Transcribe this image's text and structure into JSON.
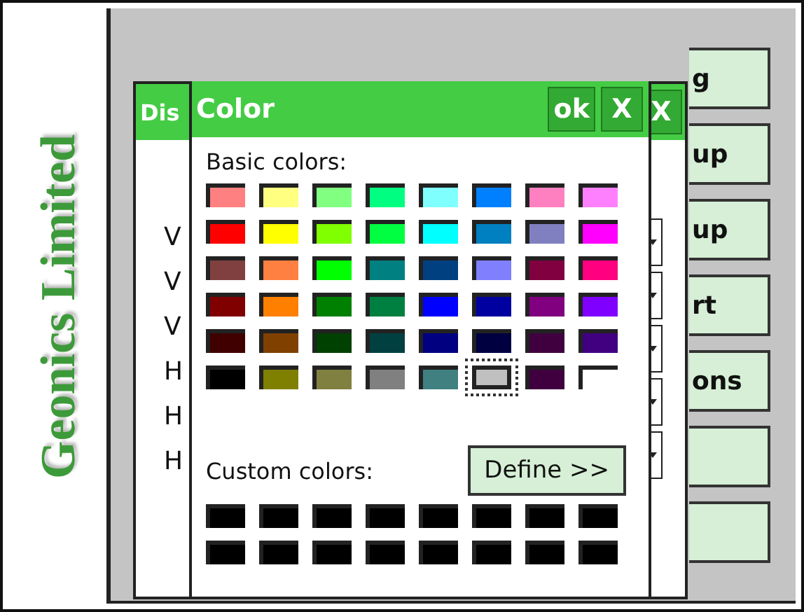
{
  "logo": {
    "text": "Geonics Limited"
  },
  "side_buttons": [
    {
      "kind": "labeled",
      "label": "g"
    },
    {
      "kind": "labeled",
      "label": "up"
    },
    {
      "kind": "labeled",
      "label": "up"
    },
    {
      "kind": "labeled",
      "label": "rt"
    },
    {
      "kind": "labeled",
      "label": "ons"
    },
    {
      "kind": "blank"
    },
    {
      "kind": "blank"
    }
  ],
  "back_dialog": {
    "title": "Dis",
    "row_labels": [
      "V",
      "V",
      "V",
      "H",
      "H",
      "H"
    ],
    "close_label": "X"
  },
  "color_dialog": {
    "title": "Color",
    "ok_label": "ok",
    "close_label": "X",
    "basic_label": "Basic colors:",
    "custom_label": "Custom colors:",
    "define_label": "Define >>",
    "basic_colors": [
      {
        "color": "#ff8080",
        "selected": false
      },
      {
        "color": "#ffff80",
        "selected": false
      },
      {
        "color": "#80ff80",
        "selected": false
      },
      {
        "color": "#00ff80",
        "selected": false
      },
      {
        "color": "#80ffff",
        "selected": false
      },
      {
        "color": "#0080ff",
        "selected": false
      },
      {
        "color": "#ff80c0",
        "selected": false
      },
      {
        "color": "#ff80ff",
        "selected": false
      },
      {
        "color": "#ff0000",
        "selected": false
      },
      {
        "color": "#ffff00",
        "selected": false
      },
      {
        "color": "#80ff00",
        "selected": false
      },
      {
        "color": "#00ff40",
        "selected": false
      },
      {
        "color": "#00ffff",
        "selected": false
      },
      {
        "color": "#0080c0",
        "selected": false
      },
      {
        "color": "#8080c0",
        "selected": false
      },
      {
        "color": "#ff00ff",
        "selected": false
      },
      {
        "color": "#804040",
        "selected": false
      },
      {
        "color": "#ff8040",
        "selected": false
      },
      {
        "color": "#00ff00",
        "selected": false
      },
      {
        "color": "#008080",
        "selected": false
      },
      {
        "color": "#004080",
        "selected": false
      },
      {
        "color": "#8080ff",
        "selected": false
      },
      {
        "color": "#800040",
        "selected": false
      },
      {
        "color": "#ff0080",
        "selected": false
      },
      {
        "color": "#800000",
        "selected": false
      },
      {
        "color": "#ff8000",
        "selected": false
      },
      {
        "color": "#008000",
        "selected": false
      },
      {
        "color": "#008040",
        "selected": false
      },
      {
        "color": "#0000ff",
        "selected": false
      },
      {
        "color": "#0000a0",
        "selected": false
      },
      {
        "color": "#800080",
        "selected": false
      },
      {
        "color": "#8000ff",
        "selected": false
      },
      {
        "color": "#400000",
        "selected": false
      },
      {
        "color": "#804000",
        "selected": false
      },
      {
        "color": "#004000",
        "selected": false
      },
      {
        "color": "#004040",
        "selected": false
      },
      {
        "color": "#000080",
        "selected": false
      },
      {
        "color": "#000040",
        "selected": false
      },
      {
        "color": "#400040",
        "selected": false
      },
      {
        "color": "#400080",
        "selected": false
      },
      {
        "color": "#000000",
        "selected": false
      },
      {
        "color": "#808000",
        "selected": false
      },
      {
        "color": "#808040",
        "selected": false
      },
      {
        "color": "#808080",
        "selected": false
      },
      {
        "color": "#408080",
        "selected": false
      },
      {
        "color": "#c0c0c0",
        "selected": true
      },
      {
        "color": "#400040",
        "selected": false
      },
      {
        "color": "#ffffff",
        "selected": false
      }
    ],
    "custom_colors": [
      {
        "color": "#000000"
      },
      {
        "color": "#000000"
      },
      {
        "color": "#000000"
      },
      {
        "color": "#000000"
      },
      {
        "color": "#000000"
      },
      {
        "color": "#000000"
      },
      {
        "color": "#000000"
      },
      {
        "color": "#000000"
      },
      {
        "color": "#000000"
      },
      {
        "color": "#000000"
      },
      {
        "color": "#000000"
      },
      {
        "color": "#000000"
      },
      {
        "color": "#000000"
      },
      {
        "color": "#000000"
      },
      {
        "color": "#000000"
      },
      {
        "color": "#000000"
      }
    ]
  }
}
